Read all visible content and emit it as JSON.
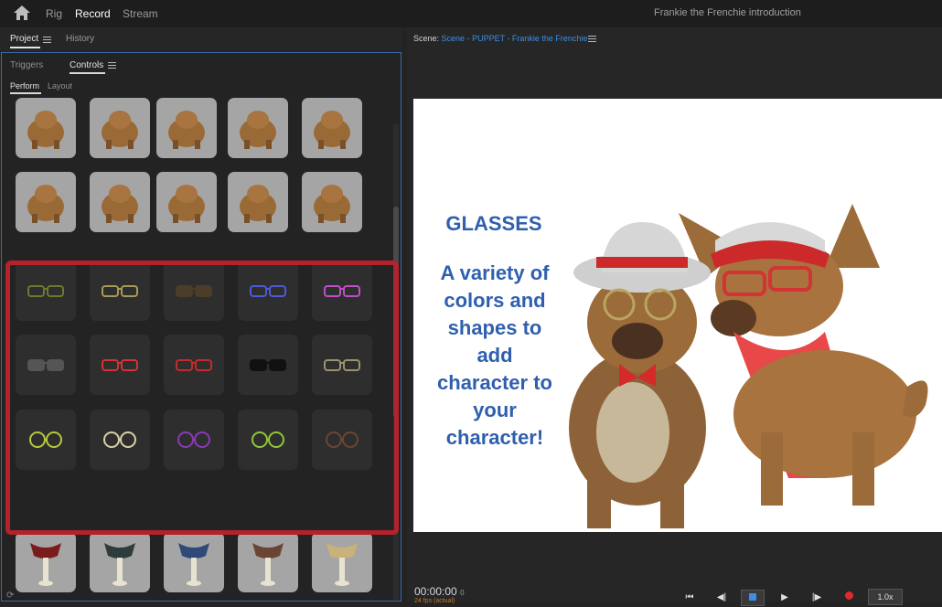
{
  "topbar": {
    "nav": [
      "Rig",
      "Record",
      "Stream"
    ],
    "active": "Record",
    "title": "Frankie the Frenchie introduction"
  },
  "left_panel": {
    "tabs": [
      "Project",
      "History"
    ],
    "sub_tabs": [
      "Triggers",
      "Controls"
    ],
    "mode_tabs": [
      "Perform",
      "Layout"
    ]
  },
  "right_panel": {
    "scene_prefix": "Scene:",
    "scene_name": "Scene - PUPPET - Frankie the Frenchie",
    "canvas_heading": "GLASSES",
    "canvas_lines": [
      "A variety of",
      "colors and",
      "shapes to",
      "add",
      "character to",
      "your",
      "character!"
    ],
    "timecode": "00:00:00",
    "timecode_frames": "0",
    "fps_note": "24 fps (actual)",
    "speed": "1.0x"
  },
  "glasses_colors": {
    "row1": [
      "#6b7a2e",
      "#a79a52",
      "#4c3d28",
      "#4b5ad8",
      "#c04ec6"
    ],
    "row2": [
      "#555555",
      "#d43333",
      "#c42b2b",
      "#111111",
      "#9c9270"
    ],
    "row3": [
      "#b8c73a",
      "#d8cfa8",
      "#8a39b8",
      "#8ec63a",
      "#6b4634"
    ]
  },
  "scarf_colors": [
    "#7a1c1c",
    "#2f3c3c",
    "#2f4a78",
    "#6b4534",
    "#c9b27a"
  ],
  "colors": {
    "accent_blue": "#3c8fe6",
    "highlight_red": "#b5222c",
    "canvas_text": "#2f5fae"
  }
}
